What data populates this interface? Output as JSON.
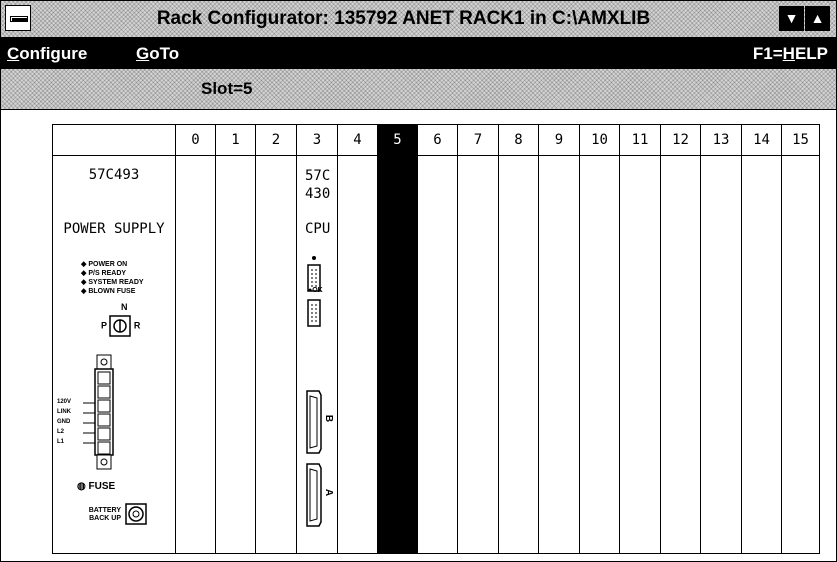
{
  "window": {
    "title": "Rack Configurator:  135792 ANET RACK1 in C:\\AMXLIB"
  },
  "menubar": {
    "configure": {
      "first": "C",
      "rest": "onfigure"
    },
    "goto": {
      "first": "G",
      "rest": "oTo"
    },
    "help": {
      "prefix": "F1=",
      "first": "H",
      "rest": "ELP"
    }
  },
  "status": {
    "slot_label": "Slot=5"
  },
  "rack": {
    "selected_slot": "5",
    "slots": [
      "0",
      "1",
      "2",
      "3",
      "4",
      "5",
      "6",
      "7",
      "8",
      "9",
      "10",
      "11",
      "12",
      "13",
      "14",
      "15"
    ],
    "power_supply": {
      "model": "57C493",
      "name": "POWER SUPPLY",
      "leds": [
        "POWER ON",
        "P/S READY",
        "SYSTEM READY",
        "BLOWN FUSE"
      ],
      "switch_top": "N",
      "switch_left": "P",
      "switch_right": "R",
      "terminal_labels": [
        "120V",
        "LINK",
        "GND",
        "L2",
        "L1"
      ],
      "fuse_label": "FUSE",
      "battery_label_1": "BATTERY",
      "battery_label_2": "BACK UP"
    },
    "cpu": {
      "model_line1": "57C",
      "model_line2": "430",
      "type": "CPU",
      "ok_label": "OK",
      "port_b": "B",
      "port_a": "A"
    }
  }
}
